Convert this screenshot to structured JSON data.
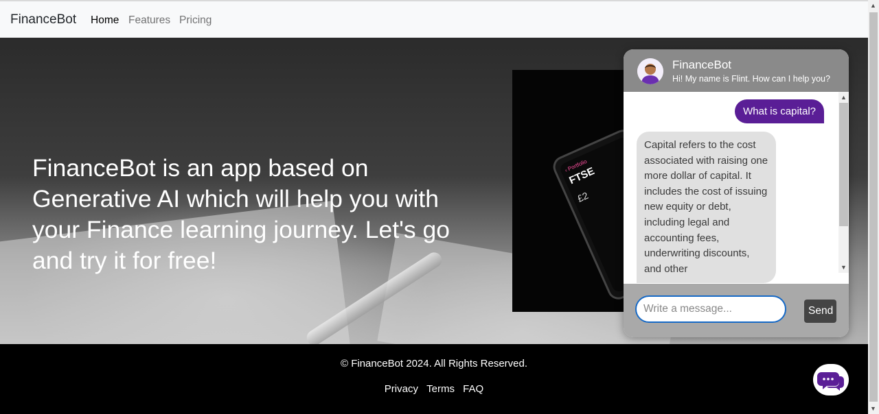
{
  "navbar": {
    "brand": "FinanceBot",
    "links": [
      {
        "label": "Home",
        "active": true
      },
      {
        "label": "Features",
        "active": false
      },
      {
        "label": "Pricing",
        "active": false
      }
    ]
  },
  "hero": {
    "headline": "FinanceBot is an app based on Generative AI which will help you with your Finance learning journey. Let's go and try it for free!"
  },
  "chat": {
    "title": "FinanceBot",
    "subtitle": "Hi! My name is Flint. How can I help you?",
    "messages": [
      {
        "from": "user",
        "text": "What is capital?"
      },
      {
        "from": "bot",
        "text": "Capital refers to the cost associated with raising one more dollar of capital. It includes the cost of issuing new equity or debt, including legal and accounting fees, underwriting discounts, and other"
      }
    ],
    "input_placeholder": "Write a message...",
    "send_label": "Send"
  },
  "footer": {
    "copyright": "© FinanceBot 2024. All Rights Reserved.",
    "links": [
      "Privacy",
      "Terms",
      "FAQ"
    ]
  },
  "colors": {
    "accent_purple": "#5a1e96",
    "chat_header": "#8a8a8a",
    "send_button": "#444444",
    "footer_bg": "#000000"
  },
  "icons": [
    "chat-bubbles-icon",
    "avatar-icon"
  ]
}
